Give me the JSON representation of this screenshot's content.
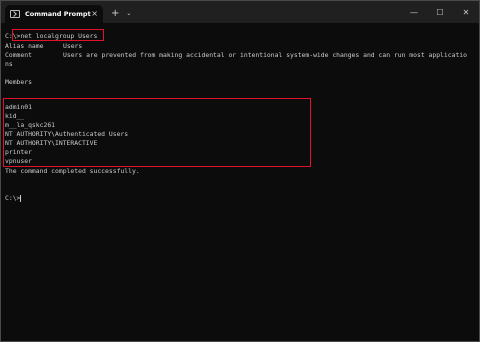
{
  "window": {
    "tab_title": "Command Prompt",
    "new_tab_label": "+",
    "dropdown_label": "⌄",
    "tab_close_label": "×",
    "minimize_label": "—",
    "maximize_label": "☐",
    "close_label": "✕"
  },
  "terminal": {
    "prompt": "C:\\",
    "command": ">net localgroup Users",
    "alias_label": "Alias name",
    "alias_value": "Users",
    "comment_label": "Comment",
    "comment_line1": "Users are prevented from making accidental or intentional system-wide changes and can run most applicatio",
    "comment_line2": "ns",
    "members_label": "Members",
    "members": [
      "admin01",
      "kid__",
      "m__la_qskc261",
      "NT AUTHORITY\\Authenticated Users",
      "NT AUTHORITY\\INTERACTIVE",
      "printer",
      "vpnuser"
    ],
    "completed_message": "The command completed successfully.",
    "final_prompt": "C:\\>"
  },
  "colors": {
    "highlight": "#e0132b",
    "terminal_bg": "#0c0c0c",
    "terminal_text": "#cccccc"
  }
}
